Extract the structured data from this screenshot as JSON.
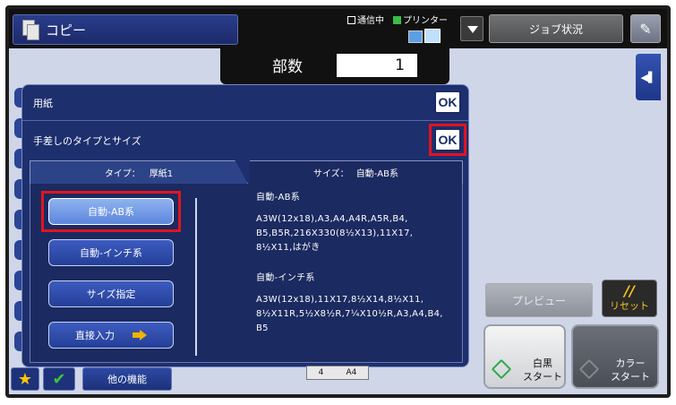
{
  "header": {
    "app_title": "コピー",
    "status_comm": "通信中",
    "status_printer": "プリンター",
    "job_status_label": "ジョブ状況"
  },
  "copies": {
    "label": "部数",
    "value": "1"
  },
  "panel": {
    "paper_label": "用紙",
    "manual_label": "手差しのタイプとサイズ",
    "ok_label": "OK",
    "tab_type_label": "タイプ：",
    "tab_type_value": "厚紙1",
    "tab_size_label": "サイズ：",
    "tab_size_value": "自動-AB系",
    "buttons": [
      "自動-AB系",
      "自動-インチ系",
      "サイズ指定",
      "直接入力"
    ],
    "ab_title": "自動-AB系",
    "ab_text": "A3W(12x18),A3,A4,A4R,A5R,B4,\nB5,B5R,216X330(8½X13),11X17,\n8½X11,はがき",
    "inch_title": "自動-インチ系",
    "inch_text": "A3W(12x18),11X17,8½X14,8½X11,\n8½X11R,5½X8½R,7¼X10½R,A3,A4,B4,\nB5"
  },
  "bottom": {
    "other_functions_label": "他の機能",
    "tray_number": "4",
    "tray_size": "A4"
  },
  "actions": {
    "preview_label": "プレビュー",
    "reset_label": "リセット",
    "bw_line1": "白黒",
    "bw_line2": "スタート",
    "color_line1": "カラー",
    "color_line2": "スタート"
  },
  "icons": {
    "app": "copy-icon",
    "printer": "printer-icon",
    "dropdown": "chevron-down-icon",
    "settings": "settings-icon",
    "favorite": "star-icon",
    "check": "check-icon",
    "arrow": "arrow-right-icon",
    "side": "panel-expand-icon"
  },
  "colors": {
    "highlight": "#e1141e",
    "panel": "#1e2f6d",
    "accent": "#f5c518"
  }
}
